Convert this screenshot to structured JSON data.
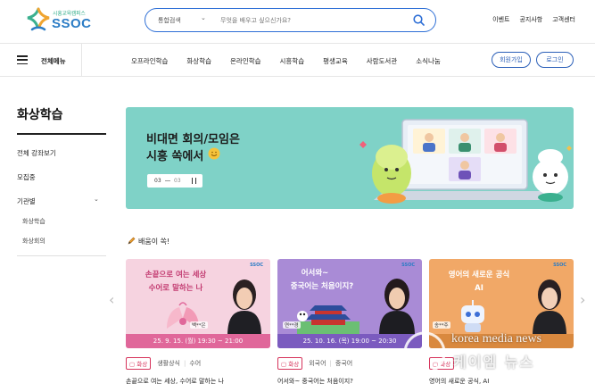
{
  "header": {
    "logo_sub": "시흥교육캠퍼스",
    "logo_main": "SSOC",
    "search_scope": "통합검색",
    "search_placeholder": "무엇을 배우고 싶으신가요?",
    "top_links": [
      "이벤트",
      "공지사항",
      "고객센터"
    ]
  },
  "nav": {
    "menu_label": "전체메뉴",
    "items": [
      "오프라인학습",
      "화상학습",
      "온라인학습",
      "시흥학습",
      "평생교육",
      "사람도서관",
      "소식나눔"
    ],
    "signup_label": "회원가입",
    "login_label": "로그인"
  },
  "sidebar": {
    "title": "화상학습",
    "items": [
      "전체 강좌보기",
      "모집중",
      "기관별"
    ],
    "sub_items": [
      "화상학습",
      "화상회의"
    ]
  },
  "banner": {
    "line1": "비대면 회의/모임은",
    "line2": "시흥 쏙에서",
    "current": "03",
    "total": "03",
    "bg_color": "#7fd2c7"
  },
  "section": {
    "title": "배움이 쏙!"
  },
  "cards": [
    {
      "thumb_line1": "손끝으로 여는 세상",
      "thumb_line2": "수어로 말하는 나",
      "presenter": "백**은",
      "when": "25. 9. 15. (월) 19:30 ~ 21:00",
      "badge": "화상",
      "category": "생활상식",
      "subcategory": "수어",
      "title": "손끝으로 여는 세상, 수어로 말하는 나",
      "bg_color": "#f6d3e0",
      "bar_color": "#e0679a"
    },
    {
      "thumb_line1": "어서와~",
      "thumb_line2": "중국어는 처음이지?",
      "presenter": "연**경",
      "when": "25. 10. 16. (목) 19:00 ~ 20:30",
      "badge": "화상",
      "category": "외국어",
      "subcategory": "중국어",
      "title": "어서와~ 중국어는 처음이지?",
      "bg_color": "#a98bd6",
      "bar_color": "#7b5bbf"
    },
    {
      "thumb_line1": "영어의 새로운 공식",
      "thumb_line2": "AI",
      "presenter": "송**주",
      "when": "",
      "badge": "화상",
      "category": "",
      "subcategory": "",
      "title": "영어의 새로운 공식, AI",
      "bg_color": "#f1a867",
      "bar_color": "#d9893f"
    }
  ],
  "watermark": {
    "en": "korea media news",
    "ko": "케이엠 뉴스",
    "mark": "kmn"
  }
}
